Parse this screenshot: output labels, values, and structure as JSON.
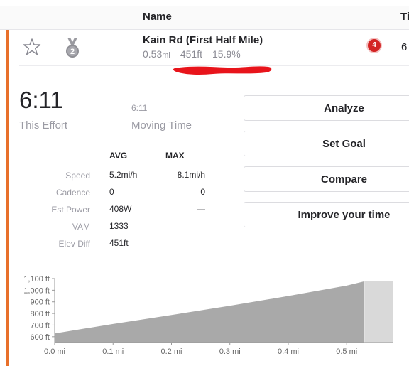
{
  "header": {
    "name_col": "Name",
    "time_col": "Ti"
  },
  "segment": {
    "name": "Kain Rd (First Half Mile)",
    "distance_value": "0.53",
    "distance_unit": "mi",
    "elevation": "451ft",
    "grade": "15.9%",
    "medal_rank": "2",
    "badge_count": "4",
    "time_cut": "6"
  },
  "effort": {
    "time": "6:11",
    "time_label": "This Effort",
    "moving_time": "6:11",
    "moving_label": "Moving Time"
  },
  "stats": {
    "avg_header": "AVG",
    "max_header": "MAX",
    "rows": [
      {
        "label": "Speed",
        "avg": "5.2mi/h",
        "max": "8.1mi/h"
      },
      {
        "label": "Cadence",
        "avg": "0",
        "max": "0"
      },
      {
        "label": "Est Power",
        "avg": "408W",
        "max": "—"
      },
      {
        "label": "VAM",
        "avg": "1333",
        "max": ""
      },
      {
        "label": "Elev Diff",
        "avg": "451ft",
        "max": ""
      }
    ]
  },
  "buttons": {
    "analyze": "Analyze",
    "set_goal": "Set Goal",
    "compare": "Compare",
    "improve": "Improve your time"
  },
  "colors": {
    "accent": "#e8702a",
    "badge": "#d32323",
    "annotation": "#e8141b",
    "chart_fill": "#a9a9a9"
  },
  "chart_data": {
    "type": "area",
    "y_ticks": [
      "600 ft",
      "700 ft",
      "800 ft",
      "900 ft",
      "1,000 ft",
      "1,100 ft"
    ],
    "x_ticks": [
      "0.0 mi",
      "0.1 mi",
      "0.2 mi",
      "0.3 mi",
      "0.4 mi",
      "0.5 mi"
    ],
    "ylim": [
      550,
      1100
    ],
    "xlim": [
      0,
      0.58
    ],
    "effort_end": 0.53,
    "series": [
      {
        "x": [
          0,
          0.1,
          0.2,
          0.3,
          0.4,
          0.5,
          0.53
        ],
        "y": [
          628,
          710,
          787,
          866,
          950,
          1040,
          1076
        ]
      },
      {
        "x": [
          0.53,
          0.58
        ],
        "y": [
          1076,
          1082
        ]
      }
    ]
  }
}
